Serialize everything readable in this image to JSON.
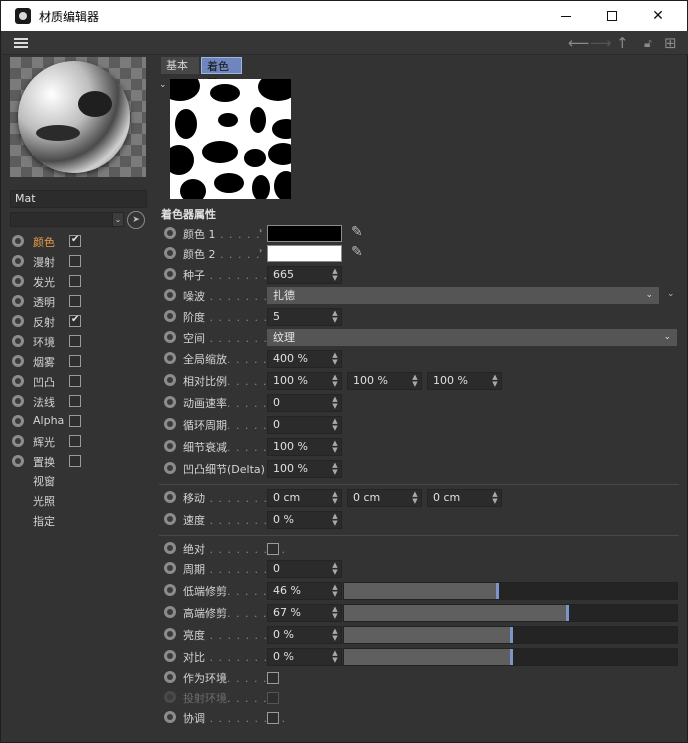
{
  "window": {
    "title": "材质编辑器"
  },
  "toolbar": {
    "back_icon": "arrow-left-icon",
    "forward_icon": "arrow-right-icon",
    "up_icon": "arrow-up-icon",
    "lock_icon": "lock-icon",
    "add_icon": "plus-square-icon"
  },
  "material": {
    "name": "Mat"
  },
  "channels": [
    {
      "label": "颜色",
      "checked": true,
      "active": true
    },
    {
      "label": "漫射",
      "checked": false
    },
    {
      "label": "发光",
      "checked": false
    },
    {
      "label": "透明",
      "checked": false
    },
    {
      "label": "反射",
      "checked": true
    },
    {
      "label": "环境",
      "checked": false
    },
    {
      "label": "烟雾",
      "checked": false
    },
    {
      "label": "凹凸",
      "checked": false
    },
    {
      "label": "法线",
      "checked": false
    },
    {
      "label": "Alpha",
      "checked": false
    },
    {
      "label": "辉光",
      "checked": false
    },
    {
      "label": "置换",
      "checked": false
    }
  ],
  "extra_items": [
    "视窗",
    "光照",
    "指定"
  ],
  "tabs": [
    "基本",
    "着色器"
  ],
  "active_tab": "着色器",
  "section_title": "着色器属性",
  "params": {
    "color1": {
      "label": "颜色 1",
      "dots": " . . . . .",
      "color": "#000000"
    },
    "color2": {
      "label": "颜色 2",
      "dots": " . . . . .",
      "color": "#ffffff"
    },
    "seed": {
      "label": "种子",
      "dots": " . . . . . . . . .",
      "value": "665"
    },
    "noise": {
      "label": "噪波",
      "dots": " . . . . . . . . .",
      "value": "扎德"
    },
    "octaves": {
      "label": "阶度",
      "dots": " . . . . . . . . .",
      "value": "5"
    },
    "space": {
      "label": "空间",
      "dots": " . . . . . . . . .",
      "value": "纹理"
    },
    "global_scale": {
      "label": "全局缩放",
      "dots": ". . . . . .",
      "value": "400 %"
    },
    "relative_scale": {
      "label": "相对比例",
      "dots": ". . . . .",
      "values": [
        "100 %",
        "100 %",
        "100 %"
      ]
    },
    "anim_speed": {
      "label": "动画速率",
      "dots": ". . . . . .",
      "value": "0"
    },
    "loop_period": {
      "label": "循环周期",
      "dots": ". . . . . .",
      "value": "0"
    },
    "detail_atten": {
      "label": "细节衰减",
      "dots": ". . . . . .",
      "value": "100 %"
    },
    "delta": {
      "label": "凹凸细节(Delta)",
      "dots": "",
      "value": "100 %"
    },
    "move": {
      "label": "移动",
      "dots": " . . . . . . . . .",
      "values": [
        "0 cm",
        "0 cm",
        "0 cm"
      ]
    },
    "speed": {
      "label": "速度",
      "dots": " . . . . . . . . .",
      "value": "0 %"
    },
    "absolute": {
      "label": "绝对",
      "dots": " . . . . . . . . .",
      "checked": false
    },
    "cycles": {
      "label": "周期",
      "dots": " . . . . . . . . .",
      "value": "0"
    },
    "low_clip": {
      "label": "低端修剪",
      "dots": ". . . . . .",
      "value": "46 %",
      "fraction": 0.46
    },
    "high_clip": {
      "label": "高端修剪",
      "dots": ". . . . . .",
      "value": "67 %",
      "fraction": 0.67
    },
    "brightness": {
      "label": "亮度",
      "dots": " . . . . . . . . .",
      "value": "0 %",
      "fraction": 0.5
    },
    "contrast": {
      "label": "对比",
      "dots": " . . . . . . . . .",
      "value": "0 %",
      "fraction": 0.5
    },
    "use_as_env": {
      "label": "作为环境",
      "dots": ". . . . . .",
      "checked": false
    },
    "project_env": {
      "label": "投射环境",
      "dots": ". . . . . .",
      "checked": false,
      "disabled": true
    },
    "blend": {
      "label": "协调",
      "dots": " . . . . . . . . .",
      "checked": false
    }
  },
  "colors": {
    "accent": "#6e86bd",
    "active_channel": "#e8a04c",
    "slider_handle": "#7d96c9"
  }
}
